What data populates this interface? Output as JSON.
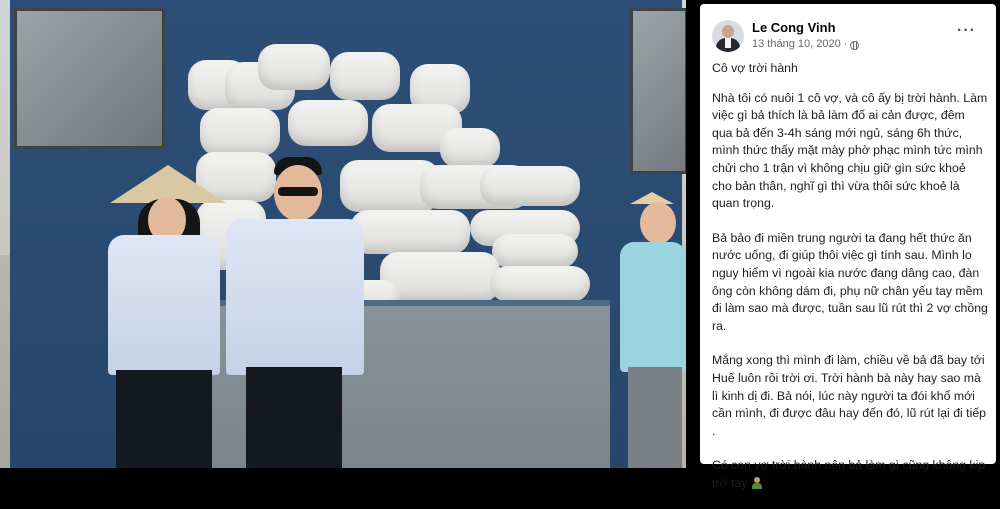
{
  "post": {
    "author": "Le Cong Vinh",
    "date": "13 tháng 10, 2020",
    "more_icon": "more-options-icon",
    "privacy_icon": "globe-icon",
    "paragraphs": [
      "Cô vợ trời hành",
      "Nhà tôi có nuôi 1 cô vợ, và cô ấy bị trời hành. Làm việc gì bả thích là bả làm đố ai cản được, đêm qua bả đến 3-4h sáng mới ngủ, sáng 6h thức, mình thức thấy mặt mày phờ phạc mình tức mình chửi cho 1 trận vì không chịu giữ gìn sức khoẻ cho bản thân, nghĩ gì thì vừa thôi sức khoẻ là quan trọng.",
      "Bả bảo đi miền trung người ta đang hết thức ăn nước uống, đi giúp thôi việc gì tính sau. Mình lo nguy hiểm vì ngoài kia nước đang dâng cao, đàn ông còn không dám đi, phụ nữ chân yếu tay mềm đi làm sao mà được, tuần sau lũ rút thì 2 vợ chồng ra.",
      "Mắng xong thì mình đi làm, chiều về bả đã bay tới Huế luôn rồi trời ơi. Trời hành bà này hay sao mà lì kinh dị đi. Bả nói, lúc này người ta đói khổ mới cần mình, đi được đâu hay đến đó, lũ rút lại đi tiếp .",
      "Có con vợ trời hành nên bả làm gì cũng không kịp trở tay"
    ]
  },
  "photo": {
    "description_icon": "photo-image"
  }
}
